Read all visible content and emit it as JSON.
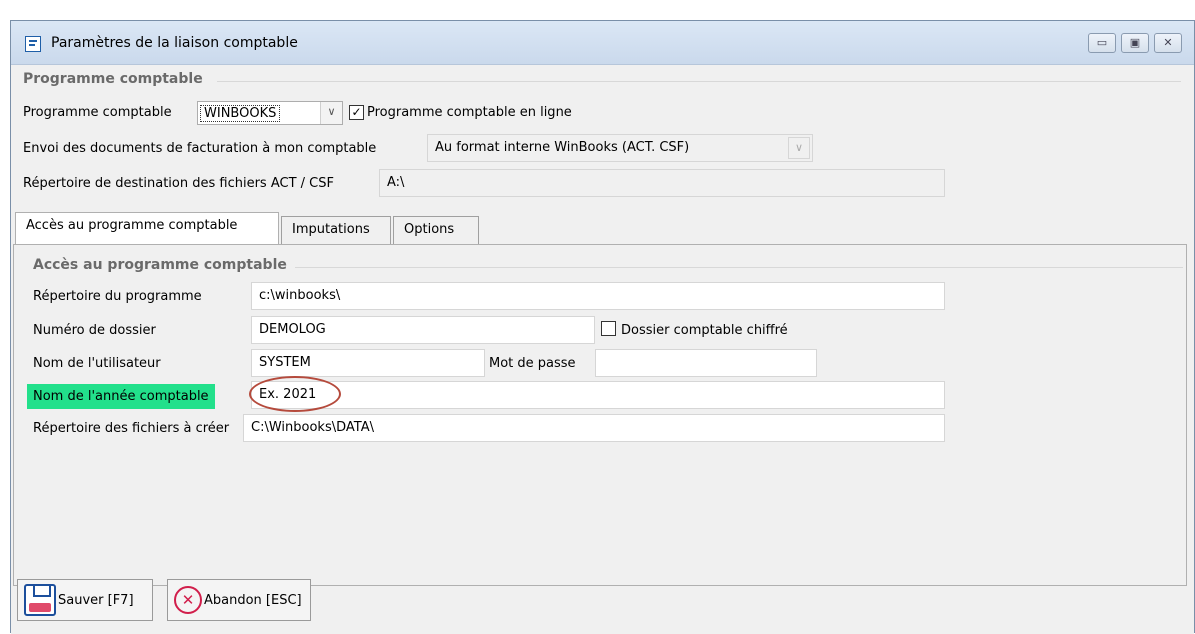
{
  "window": {
    "title": "Paramètres de la liaison comptable",
    "controls": {
      "minimize": "▭",
      "maximize": "▣",
      "close": "✕"
    }
  },
  "group_programme": {
    "legend": "Programme comptable",
    "programme_label": "Programme comptable",
    "programme_value": "WINBOOKS",
    "online_checked": "✓",
    "online_label": "Programme comptable en ligne",
    "envoi_label": "Envoi des documents de facturation à mon comptable",
    "envoi_value": "Au format interne WinBooks (ACT. CSF)",
    "repertoire_label": "Répertoire de destination des fichiers ACT / CSF",
    "repertoire_value": "A:\\"
  },
  "tabs": [
    {
      "label": "Accès au programme comptable"
    },
    {
      "label": "Imputations"
    },
    {
      "label": "Options"
    }
  ],
  "acces": {
    "legend": "Accès au programme comptable",
    "rep_prog_label": "Répertoire du programme",
    "rep_prog_value": "c:\\winbooks\\",
    "dossier_label": "Numéro de dossier",
    "dossier_value": "DEMOLOG",
    "chiffre_label": "Dossier comptable chiffré",
    "user_label": "Nom de l'utilisateur",
    "user_value": "SYSTEM",
    "password_label": "Mot de passe",
    "password_value": "",
    "annee_label": "Nom de l'année comptable",
    "annee_value": "Ex. 2021",
    "fichiers_label": "Répertoire des fichiers à créer",
    "fichiers_value": "C:\\Winbooks\\DATA\\"
  },
  "buttons": {
    "save": "Sauver [F7]",
    "cancel": "Abandon [ESC]"
  },
  "colors": {
    "highlight": "#22e08b",
    "annotation_ellipse": "#b54a3c"
  }
}
